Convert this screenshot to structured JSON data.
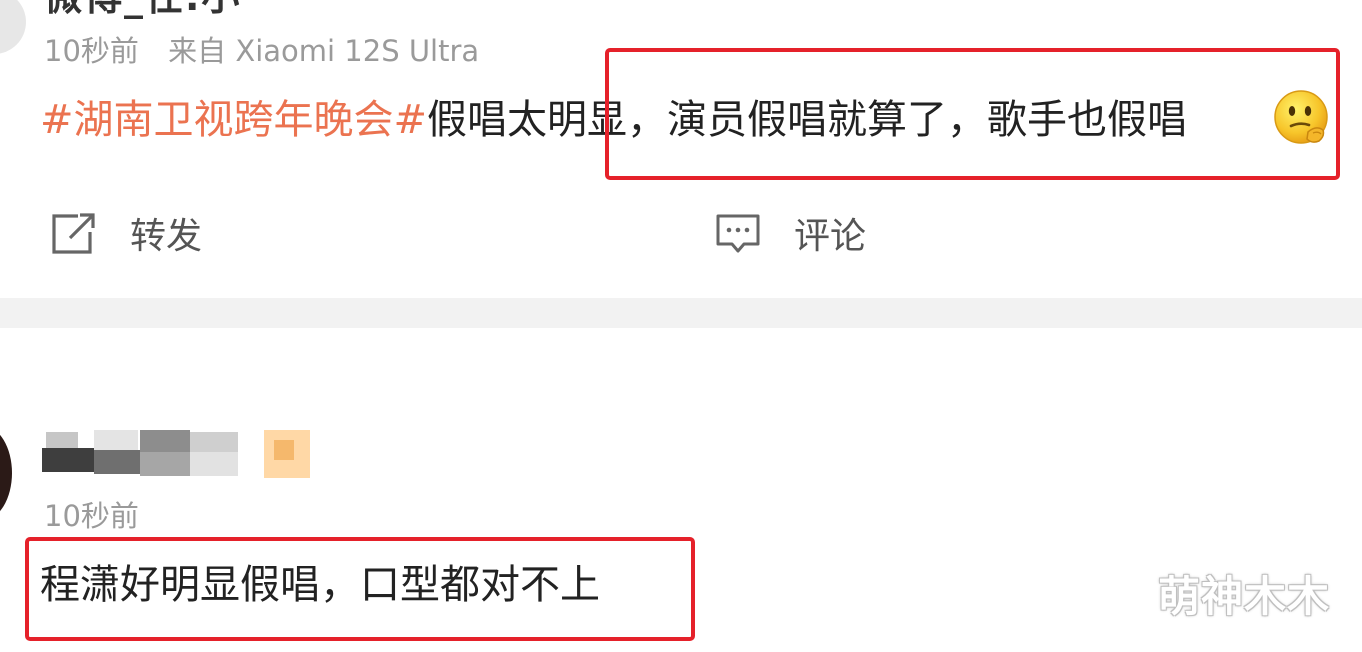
{
  "post1": {
    "author_name_cut": "微博_任.小",
    "time": "10秒前",
    "source": "来自 Xiaomi 12S Ultra",
    "hashtag": "#湖南卫视跨年晚会#",
    "text": "假唱太明显，演员假唱就算了，歌手也假唱",
    "emoji": "thinking-face-emoji",
    "repost_label": "转发",
    "comment_label": "评论"
  },
  "post2": {
    "time": "10秒前",
    "text": "程潇好明显假唱，口型都对不上"
  },
  "watermark": "萌神木木",
  "colors": {
    "hashtag": "#eb7350",
    "highlight_box": "#e5212a",
    "meta_text": "#9a9a9a",
    "body_text": "#222222",
    "separator": "#f2f2f2"
  }
}
